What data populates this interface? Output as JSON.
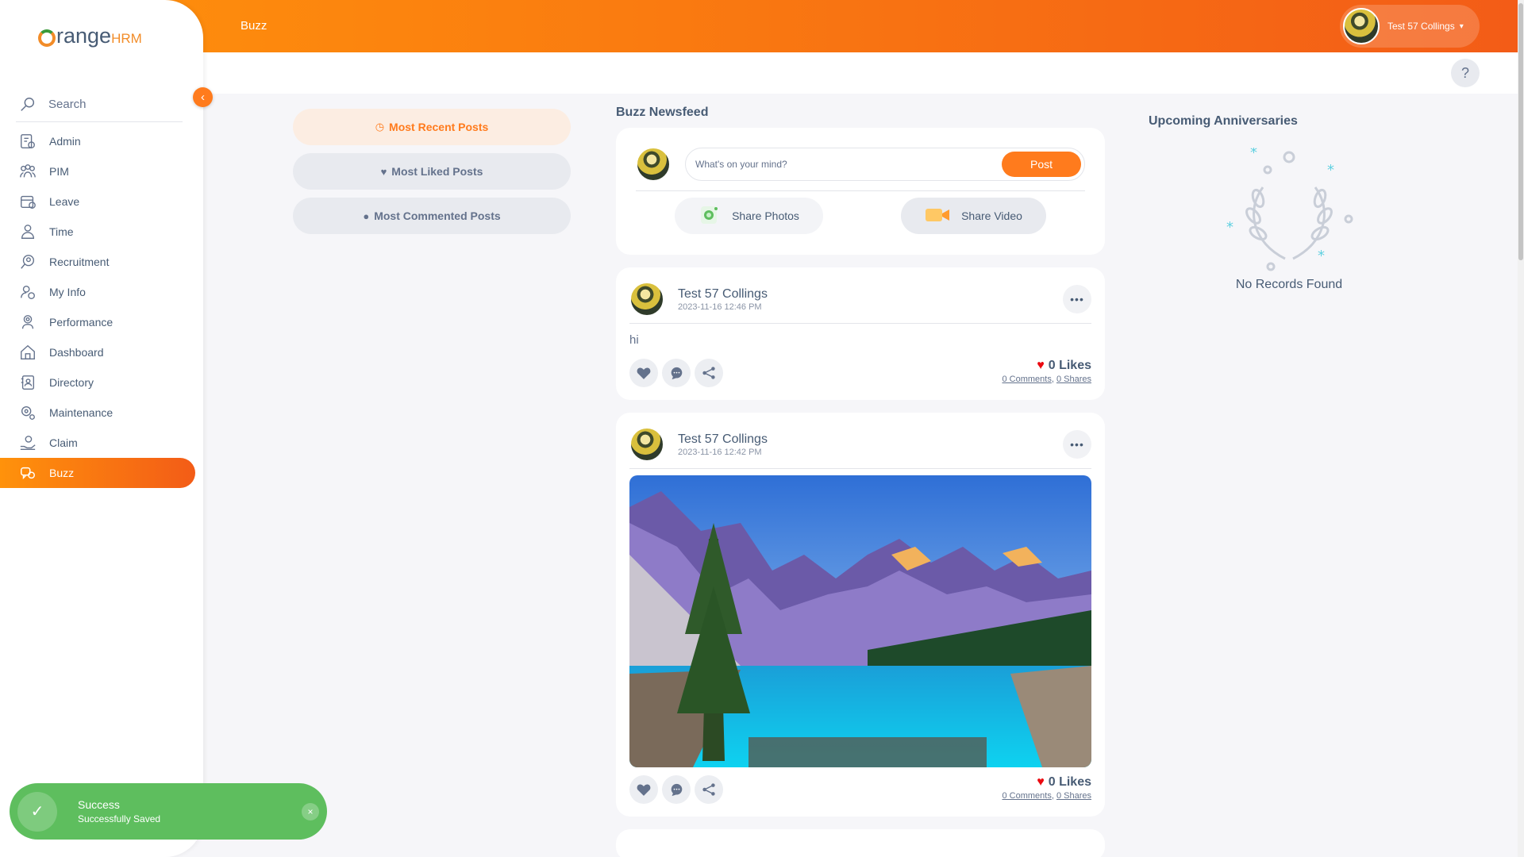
{
  "brand": {
    "name": "range",
    "suffix": "HRM"
  },
  "topbar": {
    "module_title": "Buzz",
    "user_name": "Test 57 Collings",
    "caret": "▾",
    "help": "?"
  },
  "sidebar": {
    "search_placeholder": "Search",
    "collapse_glyph": "‹",
    "items": [
      {
        "label": "Admin",
        "icon": "admin-icon"
      },
      {
        "label": "PIM",
        "icon": "pim-icon"
      },
      {
        "label": "Leave",
        "icon": "leave-icon"
      },
      {
        "label": "Time",
        "icon": "time-icon"
      },
      {
        "label": "Recruitment",
        "icon": "recruitment-icon"
      },
      {
        "label": "My Info",
        "icon": "my-info-icon"
      },
      {
        "label": "Performance",
        "icon": "performance-icon"
      },
      {
        "label": "Dashboard",
        "icon": "dashboard-icon"
      },
      {
        "label": "Directory",
        "icon": "directory-icon"
      },
      {
        "label": "Maintenance",
        "icon": "maintenance-icon"
      },
      {
        "label": "Claim",
        "icon": "claim-icon"
      },
      {
        "label": "Buzz",
        "icon": "buzz-icon",
        "active": true
      }
    ]
  },
  "filters": {
    "recent": "Most Recent Posts",
    "liked": "Most Liked Posts",
    "commented": "Most Commented Posts"
  },
  "feed": {
    "title": "Buzz Newsfeed",
    "composer": {
      "placeholder": "What's on your mind?",
      "post_label": "Post",
      "share_photos": "Share Photos",
      "share_video": "Share Video"
    },
    "posts": [
      {
        "author": "Test 57 Collings",
        "date": "2023-11-16 12:46 PM",
        "text": "hi",
        "likes": "0 Likes",
        "comments": "0 Comments",
        "separator": ",",
        "shares": "0 Shares"
      },
      {
        "author": "Test 57 Collings",
        "date": "2023-11-16 12:42 PM",
        "likes": "0 Likes",
        "comments": "0 Comments",
        "separator": ",",
        "shares": "0 Shares"
      }
    ],
    "more_glyph": "•••"
  },
  "anniversaries": {
    "title": "Upcoming Anniversaries",
    "empty": "No Records Found"
  },
  "toast": {
    "title": "Success",
    "message": "Successfully Saved",
    "check": "✓",
    "close": "×"
  },
  "colors": {
    "accent": "#ff7b1d",
    "gradient_start": "#ff920b",
    "gradient_end": "#f35c17",
    "success": "#5ebe5e",
    "like": "#eb0910"
  }
}
